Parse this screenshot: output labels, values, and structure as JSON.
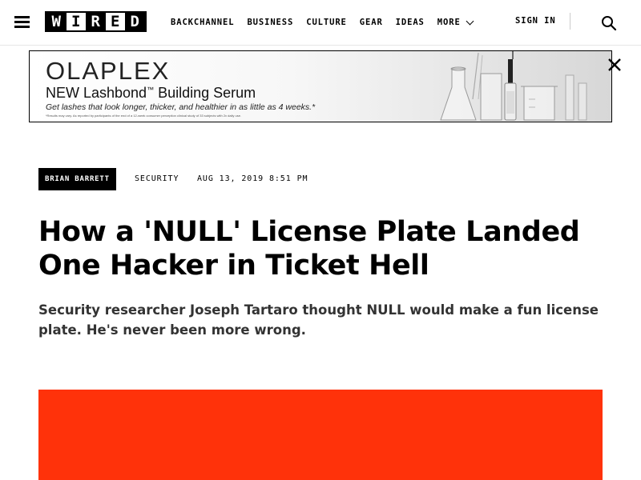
{
  "header": {
    "logo_letters": [
      "W",
      "I",
      "R",
      "E",
      "D"
    ],
    "nav": [
      {
        "label": "BACKCHANNEL"
      },
      {
        "label": "BUSINESS"
      },
      {
        "label": "CULTURE"
      },
      {
        "label": "GEAR"
      },
      {
        "label": "IDEAS"
      },
      {
        "label": "MORE"
      }
    ],
    "sign_in": "SIGN IN",
    "icons": {
      "menu": "hamburger-menu-icon",
      "search": "search-icon",
      "more": "chevron-down-icon"
    }
  },
  "ad": {
    "brand": "OLAPLEX",
    "headline_pre": "NEW Lashbond",
    "headline_tm": "™",
    "headline_post": " Building Serum",
    "subtext": "Get lashes that look longer, thicker, and healthier in as little as 4 weeks.*",
    "fine_print": "*Results may vary. As reported by participants of the end of a 12-week consumer perception clinical study of 33 subjects with 2x daily use.",
    "close_icon": "close-icon"
  },
  "article": {
    "author": "BRIAN BARRETT",
    "category": "SECURITY",
    "date": "AUG 13, 2019 8:51 PM",
    "title": "How a 'NULL' License Plate Landed One Hacker in Ticket Hell",
    "dek": "Security researcher Joseph Tartaro thought NULL would make a fun license plate. He's never been more wrong."
  },
  "colors": {
    "hero": "#ff320a",
    "text": "#000000",
    "dek": "#333333"
  }
}
